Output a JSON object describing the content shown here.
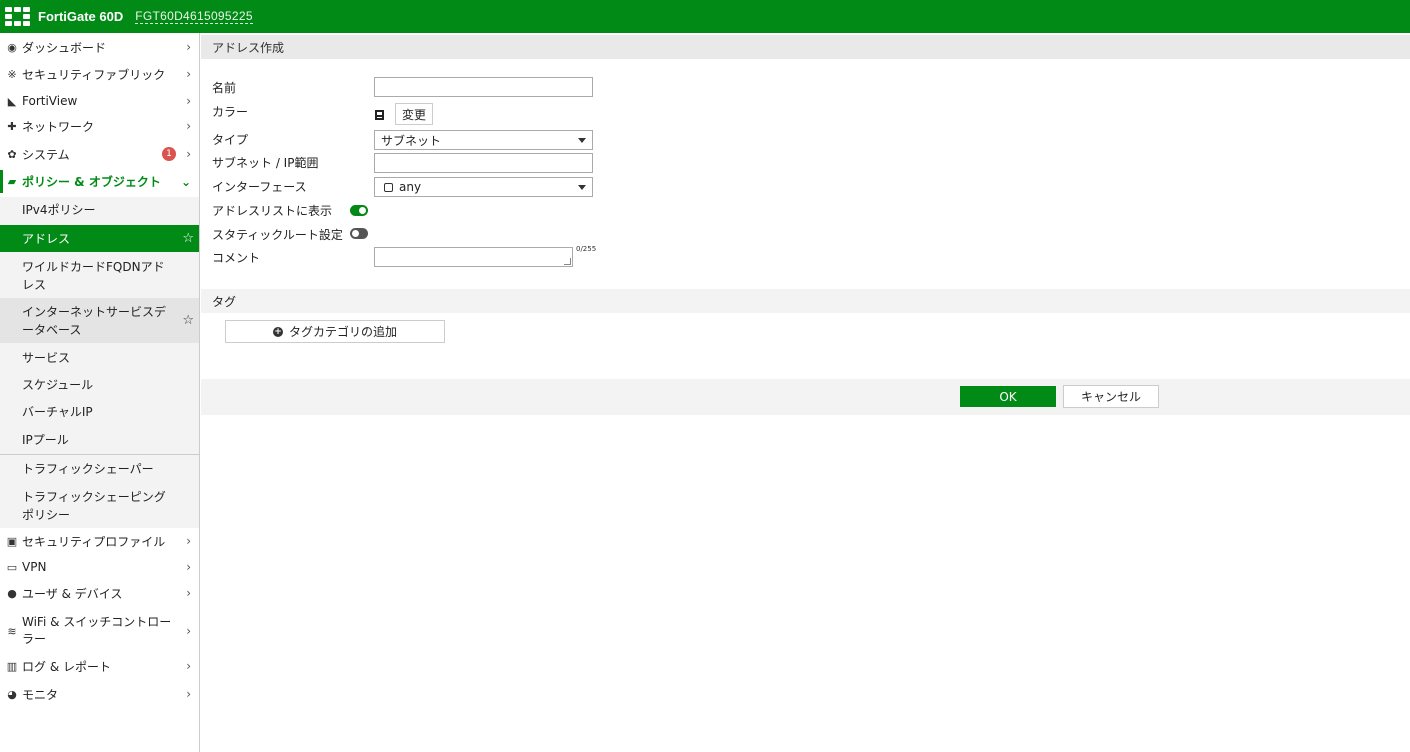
{
  "header": {
    "brand": "FortiGate 60D",
    "serial": "FGT60D4615095225"
  },
  "sidebar": {
    "items": [
      {
        "label": "ダッシュボード",
        "icon": "dashboard-icon"
      },
      {
        "label": "セキュリティファブリック",
        "icon": "fabric-icon"
      },
      {
        "label": "FortiView",
        "icon": "chart-icon"
      },
      {
        "label": "ネットワーク",
        "icon": "network-icon"
      },
      {
        "label": "システム",
        "icon": "gear-icon",
        "badge": "1"
      },
      {
        "label": "ポリシー & オブジェクト",
        "icon": "policy-icon"
      },
      {
        "label": "セキュリティプロファイル",
        "icon": "lock-icon"
      },
      {
        "label": "VPN",
        "icon": "laptop-icon"
      },
      {
        "label": "ユーザ & デバイス",
        "icon": "user-icon"
      },
      {
        "label": "WiFi & スイッチコントローラー",
        "icon": "wifi-icon"
      },
      {
        "label": "ログ & レポート",
        "icon": "report-icon"
      },
      {
        "label": "モニタ",
        "icon": "monitor-icon"
      }
    ],
    "sub_items": [
      {
        "label": "IPv4ポリシー"
      },
      {
        "label": "アドレス"
      },
      {
        "label": "ワイルドカードFQDNアドレス"
      },
      {
        "label": "インターネットサービスデータベース"
      },
      {
        "label": "サービス"
      },
      {
        "label": "スケジュール"
      },
      {
        "label": "バーチャルIP"
      },
      {
        "label": "IPプール"
      },
      {
        "label": "トラフィックシェーパー"
      },
      {
        "label": "トラフィックシェーピングポリシー"
      }
    ]
  },
  "main": {
    "title": "アドレス作成",
    "fields": {
      "name_label": "名前",
      "name_value": "",
      "color_label": "カラー",
      "color_button": "変更",
      "type_label": "タイプ",
      "type_value": "サブネット",
      "subnet_label": "サブネット / IP範囲",
      "subnet_value": "",
      "interface_label": "インターフェース",
      "interface_value": "any",
      "show_in_list_label": "アドレスリストに表示",
      "show_in_list_on": true,
      "static_route_label": "スタティックルート設定",
      "static_route_on": false,
      "comment_label": "コメント",
      "comment_counter": "0/255"
    },
    "tags_section": {
      "title": "タグ",
      "add_button": "タグカテゴリの追加"
    },
    "footer": {
      "ok": "OK",
      "cancel": "キャンセル"
    }
  },
  "colors": {
    "accent": "#018a16",
    "badge": "#d9534f"
  }
}
